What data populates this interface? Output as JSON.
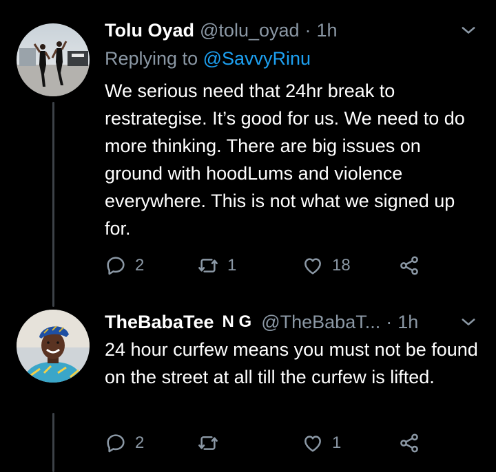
{
  "tweets": [
    {
      "name": "Tolu Oyad",
      "handle": "@tolu_oyad",
      "separator": "·",
      "time": "1h",
      "replying_label": "Replying to",
      "replying_to": "@SavvyRinu",
      "text": "We serious need that 24hr break to restrategise. It’s good for us. We need to do more thinking. There are big issues on ground with hoodLums and violence everywhere. This is not what we signed up for.",
      "counts": {
        "reply": "2",
        "retweet": "1",
        "like": "18"
      },
      "avatar_icon": "avatar-photo-two-dancers"
    },
    {
      "name": "TheBabaTee",
      "flag": "N G",
      "handle": "@TheBabaT...",
      "separator": "·",
      "time": "1h",
      "text": "24 hour curfew means you must not be found on the street at all till the curfew is lifted.",
      "counts": {
        "reply": "2",
        "retweet": "",
        "like": "1"
      },
      "avatar_icon": "avatar-photo-man-cap"
    }
  ],
  "icons": {
    "reply": "reply-icon",
    "retweet": "retweet-icon",
    "like": "heart-icon",
    "share": "share-icon",
    "more": "chevron-down-icon"
  },
  "colors": {
    "background": "#000000",
    "secondary_text": "#8b98a5",
    "mention": "#1da1f2",
    "thread_line": "#3d4248"
  }
}
